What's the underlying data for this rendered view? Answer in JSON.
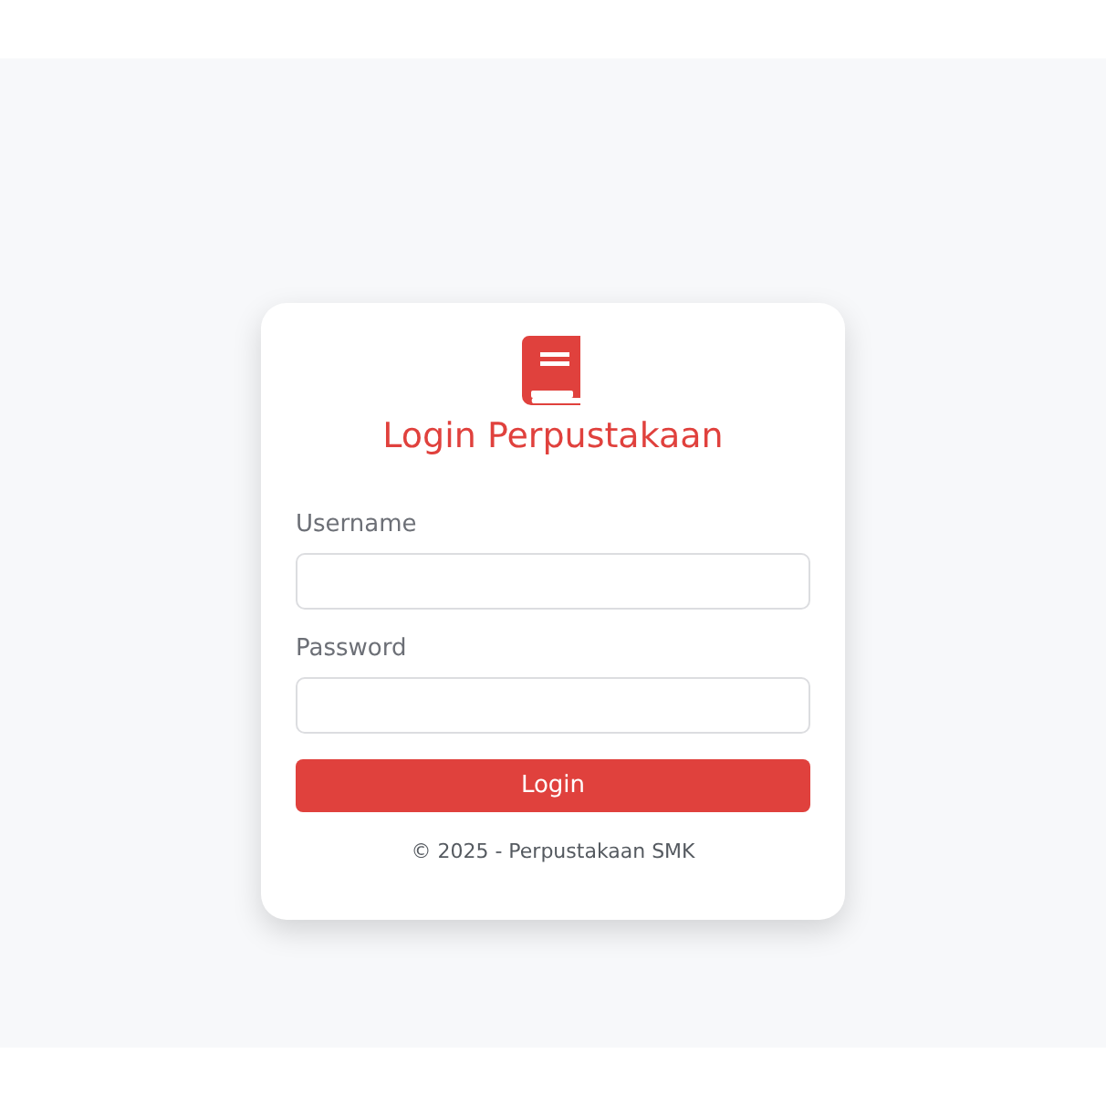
{
  "title": "Login Perpustakaan",
  "fields": [
    {
      "label": "Username"
    },
    {
      "label": "Password"
    }
  ],
  "button": "Login",
  "footer": "© 2025 - Perpustakaan SMK"
}
